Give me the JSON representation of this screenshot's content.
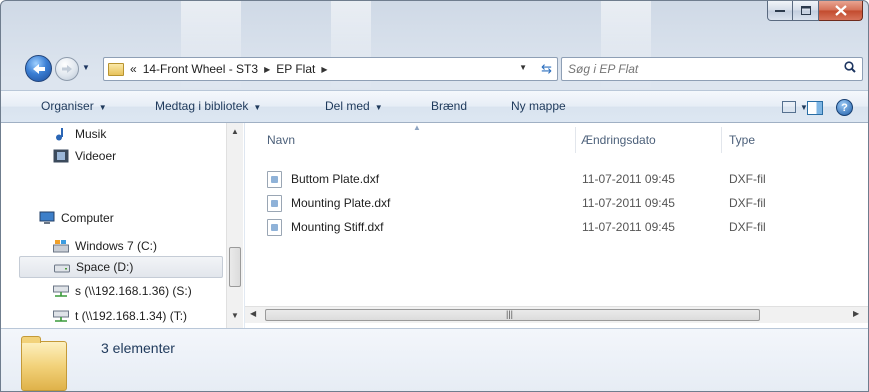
{
  "address": {
    "crumbs": [
      "14-Front Wheel - ST3",
      "EP Flat"
    ],
    "overflow_glyph": "«"
  },
  "search": {
    "placeholder": "Søg i EP Flat"
  },
  "toolbar": {
    "organize": "Organiser",
    "include_library": "Medtag i bibliotek",
    "share": "Del med",
    "burn": "Brænd",
    "new_folder": "Ny mappe"
  },
  "nav_pane": {
    "items": [
      {
        "label": "Musik",
        "icon": "music-icon"
      },
      {
        "label": "Videoer",
        "icon": "video-icon"
      },
      {
        "label": "Computer",
        "icon": "computer-icon"
      },
      {
        "label": "Windows 7 (C:)",
        "icon": "drive-icon"
      },
      {
        "label": "Space (D:)",
        "icon": "drive-icon",
        "selected": true
      },
      {
        "label": "s (\\\\192.168.1.36) (S:)",
        "icon": "network-drive-icon"
      },
      {
        "label": "t (\\\\192.168.1.34) (T:)",
        "icon": "network-drive-icon"
      }
    ]
  },
  "columns": {
    "name": "Navn",
    "date": "Ændringsdato",
    "type": "Type"
  },
  "files": [
    {
      "name": "Buttom Plate.dxf",
      "date": "11-07-2011 09:45",
      "type": "DXF-fil"
    },
    {
      "name": "Mounting Plate.dxf",
      "date": "11-07-2011 09:45",
      "type": "DXF-fil"
    },
    {
      "name": "Mounting Stiff.dxf",
      "date": "11-07-2011 09:45",
      "type": "DXF-fil"
    }
  ],
  "details": {
    "item_count": "3 elementer"
  },
  "colors": {
    "accent": "#1e395b",
    "close_button": "#c24a2d"
  }
}
